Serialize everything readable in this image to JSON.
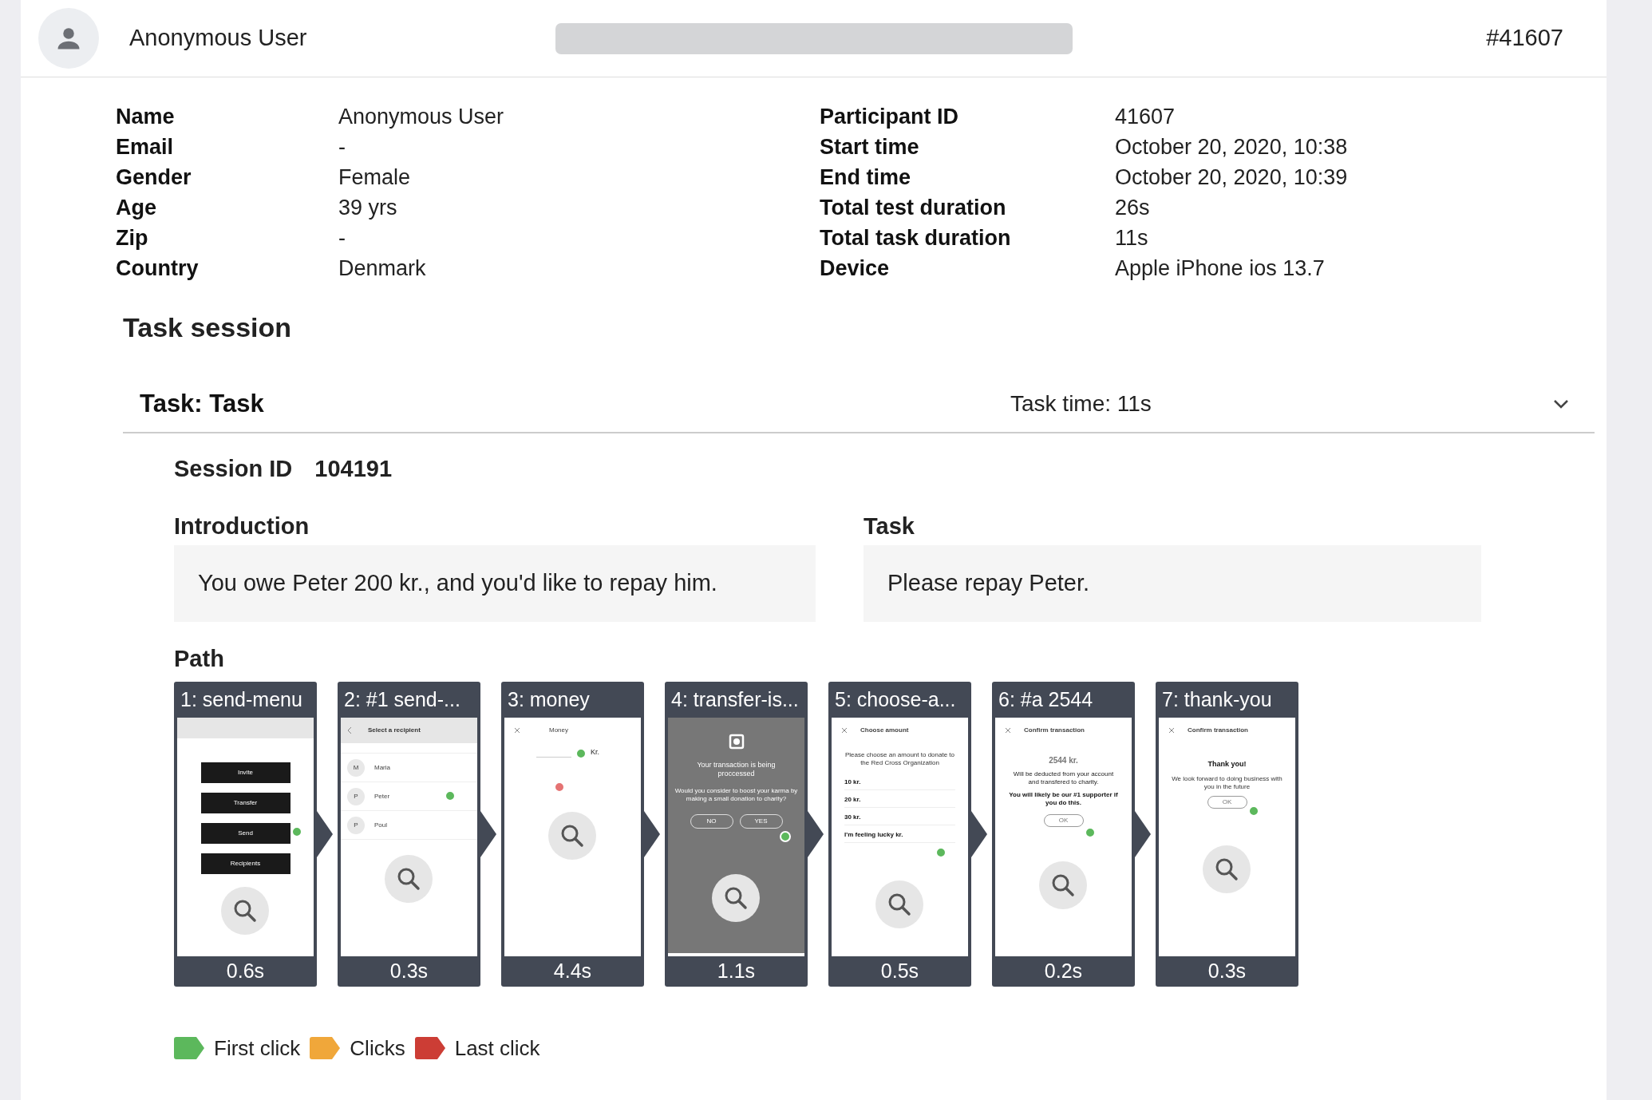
{
  "header": {
    "user": "Anonymous User",
    "id": "#41607"
  },
  "details_left": [
    {
      "label": "Name",
      "value": "Anonymous User"
    },
    {
      "label": "Email",
      "value": "-"
    },
    {
      "label": "Gender",
      "value": "Female"
    },
    {
      "label": "Age",
      "value": "39 yrs"
    },
    {
      "label": "Zip",
      "value": "-"
    },
    {
      "label": "Country",
      "value": "Denmark"
    }
  ],
  "details_right": [
    {
      "label": "Participant ID",
      "value": "41607"
    },
    {
      "label": "Start time",
      "value": "October 20, 2020, 10:38"
    },
    {
      "label": "End time",
      "value": "October 20, 2020, 10:39"
    },
    {
      "label": "Total test duration",
      "value": "26s"
    },
    {
      "label": "Total task duration",
      "value": "11s"
    },
    {
      "label": "Device",
      "value": "Apple iPhone ios 13.7"
    }
  ],
  "section_title": "Task session",
  "task": {
    "title": "Task: Task",
    "time": "Task time: 11s",
    "expanded": true
  },
  "session": {
    "label": "Session ID",
    "value": "104191"
  },
  "introduction": {
    "label": "Introduction",
    "text": "You owe Peter 200 kr., and you'd like to repay him."
  },
  "task_text": {
    "label": "Task",
    "text": "Please repay Peter."
  },
  "path": {
    "label": "Path",
    "steps": [
      {
        "label": "1: send-menu",
        "time": "0.6s",
        "screen": {
          "kind": "menu",
          "buttons": [
            "Invite",
            "Transfer",
            "Send",
            "Recipients"
          ]
        },
        "clicks": [
          {
            "color": "#5cb85c"
          }
        ]
      },
      {
        "label": "2: #1 send-...",
        "time": "0.3s",
        "screen": {
          "kind": "list",
          "header": "Select a recipient",
          "items": [
            {
              "initial": "M",
              "name": "Maria"
            },
            {
              "initial": "P",
              "name": "Peter"
            },
            {
              "initial": "P",
              "name": "Poul"
            }
          ]
        },
        "clicks": [
          {
            "color": "#5cb85c"
          }
        ]
      },
      {
        "label": "3: money",
        "time": "4.4s",
        "screen": {
          "kind": "amount",
          "header": "Money",
          "unit": "Kr."
        },
        "clicks": [
          {
            "color": "#5cb85c"
          },
          {
            "color": "#e57373"
          }
        ]
      },
      {
        "label": "4: transfer-is...",
        "time": "1.1s",
        "screen": {
          "kind": "dialog",
          "title": "Your transaction is being proccessed",
          "text": "Would you consider to boost your karma by making a small donation to charity?",
          "buttons": [
            "NO",
            "YES"
          ]
        },
        "clicks": [
          {
            "color": "#5cb85c"
          }
        ]
      },
      {
        "label": "5: choose-a...",
        "time": "0.5s",
        "screen": {
          "kind": "options",
          "header": "Choose amount",
          "text": "Please choose an amount to donate to the Red Cross Organization",
          "options": [
            "10 kr.",
            "20 kr.",
            "30 kr.",
            "I'm feeling lucky kr."
          ]
        },
        "clicks": [
          {
            "color": "#5cb85c"
          }
        ]
      },
      {
        "label": "6: #a 2544",
        "time": "0.2s",
        "screen": {
          "kind": "confirm",
          "header": "Confirm transaction",
          "amount": "2544 kr.",
          "text": "Will be deducted from your account and transfered to charity.",
          "note": "You will likely be our #1 supporter if you do this.",
          "button": "OK"
        },
        "clicks": [
          {
            "color": "#5cb85c"
          }
        ]
      },
      {
        "label": "7: thank-you",
        "time": "0.3s",
        "screen": {
          "kind": "thanks",
          "header": "Confirm transaction",
          "title": "Thank you!",
          "text": "We look forward to doing business with you in the future",
          "button": "OK"
        },
        "clicks": [
          {
            "color": "#5cb85c"
          }
        ]
      }
    ]
  },
  "legend": [
    {
      "label": "First click",
      "color": "#5cb85c"
    },
    {
      "label": "Clicks",
      "color": "#f0a73a"
    },
    {
      "label": "Last click",
      "color": "#cc3d35"
    }
  ]
}
